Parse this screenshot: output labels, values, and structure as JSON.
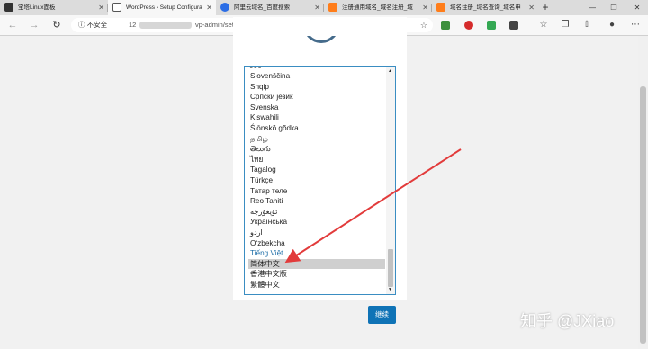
{
  "tabs": [
    {
      "label": "宝塔Linux面板",
      "favicon_color": "#333333",
      "active": false
    },
    {
      "label": "WordPress › Setup Configura",
      "favicon_color": "#ffffff",
      "active": true
    },
    {
      "label": "阿里云域名_百度搜索",
      "favicon_color": "#2b6de5",
      "active": false
    },
    {
      "label": "注册通用域名_域名注册_域",
      "favicon_color": "#ff7d1a",
      "active": false
    },
    {
      "label": "域名注册_域名查询_域名申",
      "favicon_color": "#ff7d1a",
      "active": false
    }
  ],
  "new_tab_label": "+",
  "window_controls": {
    "minimize": "—",
    "maximize": "❐",
    "close": "✕"
  },
  "toolbar": {
    "security_label": "ⓘ 不安全",
    "url_prefix": "12",
    "url_suffix": "vp-admin/setup-config.php"
  },
  "languages": [
    "Slovenščina",
    "Shqip",
    "Српски језик",
    "Svenska",
    "Kiswahili",
    "Ślōnskŏ gŏdka",
    "தமிழ்",
    "తెలుగు",
    "ไทย",
    "Tagalog",
    "Türkçe",
    "Татар теле",
    "Reo Tahiti",
    "ئۇيغۇرچە",
    "Українська",
    "اردو",
    "Oʻzbekcha",
    "Tiếng Việt",
    "简体中文",
    "香港中文版",
    "繁體中文"
  ],
  "selected_language": "简体中文",
  "continue_label": "继续",
  "watermark": "知乎 @JXiao",
  "colors": {
    "accent": "#0f73b6",
    "annotation_arrow": "#e23b3b",
    "select_border": "#3a8dc2"
  }
}
